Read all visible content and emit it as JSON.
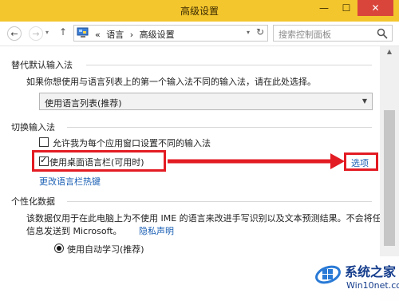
{
  "window": {
    "title": "高级设置",
    "minimize_glyph": "—",
    "maximize_glyph": "☐",
    "close_glyph": "✕"
  },
  "nav": {
    "back_glyph": "←",
    "forward_glyph": "→",
    "dropdown_glyph": "▾",
    "up_glyph": "↑"
  },
  "address": {
    "icon": "control-panel-icon",
    "prefix": "«",
    "crumbs": [
      "语言",
      "›",
      "高级设置"
    ],
    "dropdown_glyph": "▾",
    "refresh_glyph": "↻"
  },
  "search": {
    "placeholder": "搜索控制面板",
    "icon": "search-icon"
  },
  "sections": {
    "default_input": {
      "heading": "替代默认输入法",
      "description": "如果你想使用与语言列表上的第一个输入法不同的输入法，请在此处选择。",
      "select_value": "使用语言列表(推荐)"
    },
    "switch_input": {
      "heading": "切换输入法",
      "checkbox_per_app": "允许我为每个应用窗口设置不同的输入法",
      "checkbox_per_app_checked": false,
      "checkbox_langbar": "使用桌面语言栏(可用时)",
      "checkbox_langbar_checked": true,
      "options_link": "选项",
      "hotkeys_link": "更改语言栏热键"
    },
    "personalization": {
      "heading": "个性化数据",
      "description_line1": "该数据仅用于在此电脑上为不使用 IME 的语言来改进手写识别以及文本预测结果。不会将任何",
      "description_line2": "信息发送到 Microsoft。",
      "privacy_link": "隐私声明",
      "radio_auto": "使用自动学习(推荐)",
      "radio_auto_selected": true
    }
  },
  "watermark": {
    "title": "系统之家",
    "url": "Win10net.com"
  },
  "colors": {
    "titlebar": "#f3c62e",
    "close_button": "#d9453b",
    "highlight": "#e31b23",
    "link": "#1a5fb4"
  }
}
